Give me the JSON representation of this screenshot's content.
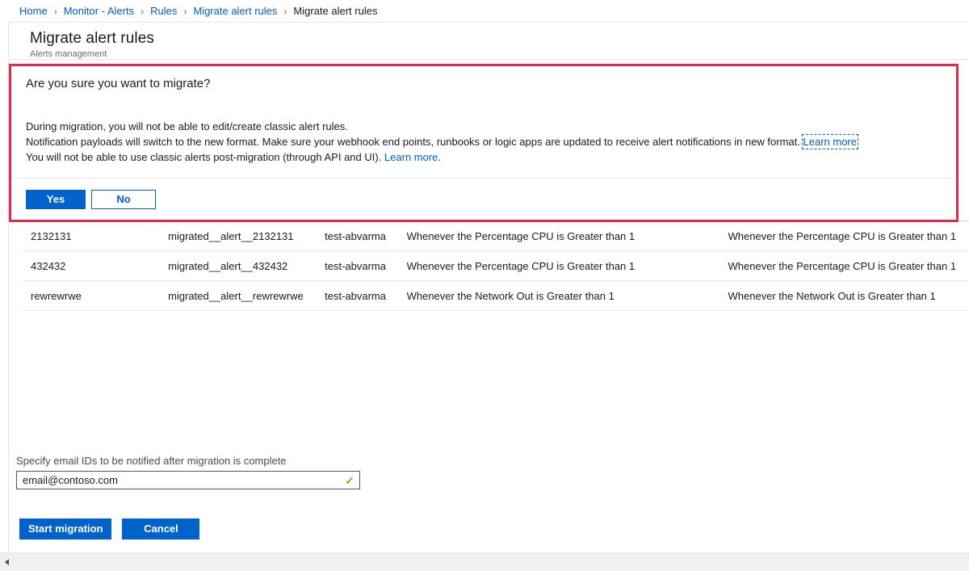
{
  "breadcrumb": {
    "items": [
      {
        "label": "Home",
        "link": true
      },
      {
        "label": "Monitor - Alerts",
        "link": true
      },
      {
        "label": "Rules",
        "link": true
      },
      {
        "label": "Migrate alert rules",
        "link": true
      },
      {
        "label": "Migrate alert rules",
        "link": false
      }
    ],
    "separator": "›"
  },
  "header": {
    "title": "Migrate alert rules",
    "subtitle": "Alerts management"
  },
  "confirm": {
    "heading": "Are you sure you want to migrate?",
    "line1": "During migration, you will not be able to edit/create classic alert rules.",
    "line2_a": "Notification payloads will switch to the new format. Make sure your webhook end points, runbooks or logic apps are updated to receive alert notifications in new format. ",
    "line2_link": "Learn more",
    "line3_a": "You will not be able to use classic alerts post-migration (through API and UI). ",
    "line3_link": "Learn more",
    "line3_b": ".",
    "yes_label": "Yes",
    "no_label": "No",
    "border_color": "#e8264b"
  },
  "grid": {
    "rows": [
      {
        "name": "2132131",
        "new_name": "migrated__alert__2132131",
        "resource_group": "test-abvarma",
        "condition": "Whenever the Percentage CPU is Greater than 1",
        "new_condition": "Whenever the Percentage CPU is Greater than 1"
      },
      {
        "name": "432432",
        "new_name": "migrated__alert__432432",
        "resource_group": "test-abvarma",
        "condition": "Whenever the Percentage CPU is Greater than 1",
        "new_condition": "Whenever the Percentage CPU is Greater than 1"
      },
      {
        "name": "rewrewrwe",
        "new_name": "migrated__alert__rewrewrwe",
        "resource_group": "test-abvarma",
        "condition": "Whenever the Network Out is Greater than 1",
        "new_condition": "Whenever the Network Out is Greater than 1"
      }
    ]
  },
  "email": {
    "label": "Specify email IDs to be notified after migration is complete",
    "value": "email@contoso.com",
    "placeholder": "email@contoso.com",
    "valid_icon": "✓",
    "valid_color": "#7ab800",
    "border_color": "#7d3f98"
  },
  "footer": {
    "start_label": "Start migration",
    "cancel_label": "Cancel"
  },
  "scrollbar": {
    "left_arrow": "left-arrow-icon"
  },
  "theme": {
    "accent_blue": "#0063cc",
    "link_blue": "#015cda"
  }
}
